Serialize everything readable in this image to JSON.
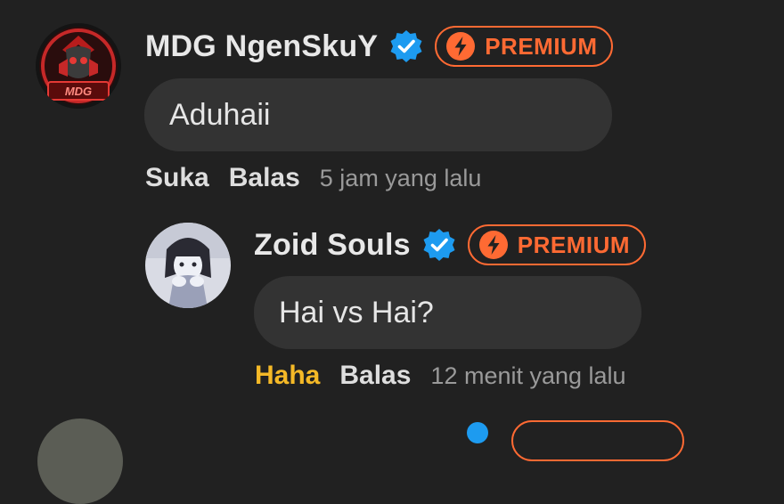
{
  "comments": [
    {
      "username": "MDG NgenSkuY",
      "verified_icon": "verified-badge-icon",
      "premium_icon": "lightning-bolt-icon",
      "premium_label": "PREMIUM",
      "message": "Aduhaii",
      "like_label": "Suka",
      "reply_label": "Balas",
      "timestamp": "5 jam yang lalu",
      "avatar_text": "MDG"
    },
    {
      "username": "Zoid Souls",
      "verified_icon": "verified-badge-icon",
      "premium_icon": "lightning-bolt-icon",
      "premium_label": "PREMIUM",
      "message": "Hai vs Hai?",
      "like_label": "Haha",
      "reply_label": "Balas",
      "timestamp": "12 menit yang lalu"
    }
  ],
  "colors": {
    "background": "#212121",
    "bubble": "#333333",
    "premium_accent": "#ff6a33",
    "verified_blue": "#1d9bf0",
    "reaction_haha": "#f5b927"
  }
}
